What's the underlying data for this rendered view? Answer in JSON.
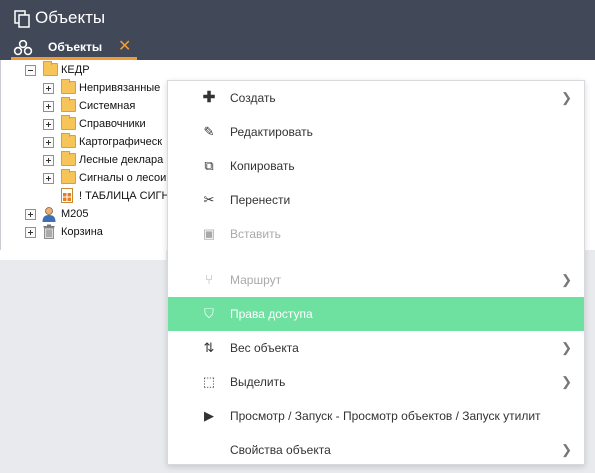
{
  "window": {
    "title": "Объекты",
    "title_icon": "copy-icon"
  },
  "tabs": [
    {
      "label": "Объекты",
      "icon": "objects-icon",
      "close": "✕"
    }
  ],
  "tree": [
    {
      "label": "КЕДР",
      "icon": "folder-icon",
      "state": "expanded"
    },
    {
      "label": "Непривязанные",
      "icon": "folder-icon",
      "state": "collapsed"
    },
    {
      "label": "Системная",
      "icon": "folder-icon",
      "state": "collapsed"
    },
    {
      "label": "Справочники",
      "icon": "folder-icon",
      "state": "collapsed"
    },
    {
      "label": "Картографическ",
      "icon": "folder-icon",
      "state": "collapsed"
    },
    {
      "label": "Лесные деклара",
      "icon": "folder-icon",
      "state": "collapsed"
    },
    {
      "label": "Сигналы о лесои",
      "icon": "folder-icon",
      "state": "collapsed"
    },
    {
      "label": "! ТАБЛИЦА СИГН",
      "icon": "table-icon",
      "state": "leaf"
    },
    {
      "label": "М205",
      "icon": "user-icon",
      "state": "collapsed"
    },
    {
      "label": "Корзина",
      "icon": "trash-icon",
      "state": "collapsed"
    }
  ],
  "context_menu": [
    {
      "label": "Создать",
      "icon": "plus-icon",
      "glyph": "✚",
      "submenu": true,
      "disabled": false,
      "active": false
    },
    {
      "label": "Редактировать",
      "icon": "edit-icon",
      "glyph": "✎",
      "submenu": false,
      "disabled": false,
      "active": false
    },
    {
      "label": "Копировать",
      "icon": "copy-icon",
      "glyph": "⧉",
      "submenu": false,
      "disabled": false,
      "active": false
    },
    {
      "label": "Перенести",
      "icon": "scissors-icon",
      "glyph": "✂",
      "submenu": false,
      "disabled": false,
      "active": false
    },
    {
      "label": "Вставить",
      "icon": "paste-icon",
      "glyph": "▣",
      "submenu": false,
      "disabled": true,
      "active": false
    },
    {
      "label": "Маршрут",
      "icon": "route-icon",
      "glyph": "⑂",
      "submenu": true,
      "disabled": true,
      "active": false
    },
    {
      "label": "Права доступа",
      "icon": "shield-icon",
      "glyph": "⛉",
      "submenu": false,
      "disabled": false,
      "active": true
    },
    {
      "label": "Вес объекта",
      "icon": "sort-icon",
      "glyph": "⇅",
      "submenu": true,
      "disabled": false,
      "active": false
    },
    {
      "label": "Выделить",
      "icon": "select-icon",
      "glyph": "⬚",
      "submenu": true,
      "disabled": false,
      "active": false
    },
    {
      "label": "Просмотр / Запуск - Просмотр объектов / Запуск утилит",
      "icon": "play-icon",
      "glyph": "▶",
      "submenu": false,
      "disabled": false,
      "active": false
    },
    {
      "label": "Свойства объекта",
      "icon": "",
      "glyph": "",
      "submenu": true,
      "disabled": false,
      "active": false
    }
  ],
  "colors": {
    "header": "#414959",
    "accent": "#f29a33",
    "active_item": "#6ee1a1"
  }
}
